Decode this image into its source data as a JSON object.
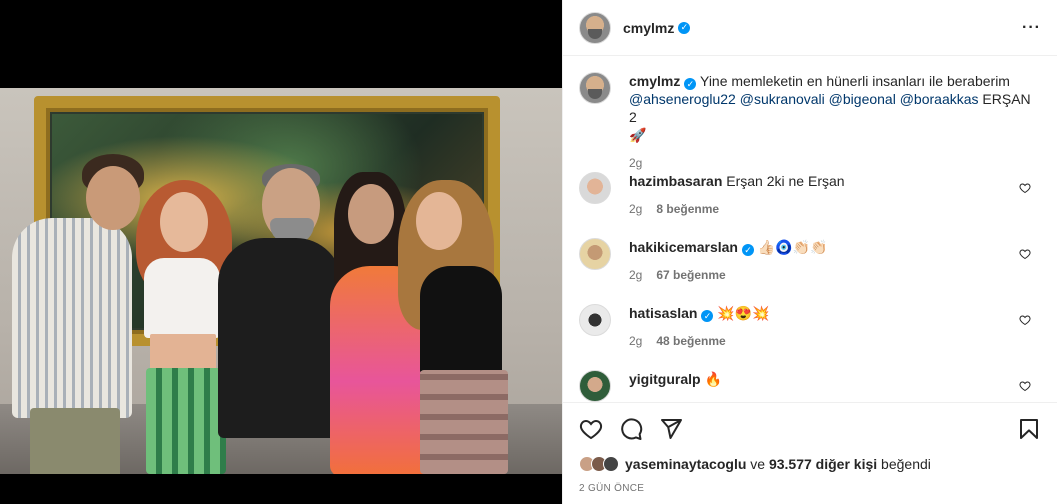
{
  "post": {
    "author": "cmylmz",
    "more_icon": "more-horizontal-icon"
  },
  "caption": {
    "username": "cmylmz",
    "text": "Yine memleketin en hünerli insanları ile beraberim",
    "mentions": [
      "@ahseneroglu22",
      "@sukranovali",
      "@bigeonal",
      "@boraakkas"
    ],
    "tail": "ERŞAN 2",
    "emoji": "🚀",
    "time": "2g"
  },
  "comments": [
    {
      "username": "hazimbasaran",
      "verified": false,
      "text": "Erşan 2ki ne Erşan",
      "time": "2g",
      "likes": "8 beğenme"
    },
    {
      "username": "hakikicemarslan",
      "verified": true,
      "text": "👍🏻🧿👏🏻👏🏻",
      "time": "2g",
      "likes": "67 beğenme"
    },
    {
      "username": "hatisaslan",
      "verified": true,
      "text": "💥😍💥",
      "time": "2g",
      "likes": "48 beğenme"
    },
    {
      "username": "yigitguralp",
      "verified": false,
      "text": "🔥",
      "time": "",
      "likes": ""
    }
  ],
  "likes_line": {
    "user": "yaseminaytacoglu",
    "conjunction": "ve",
    "count": "93.577 diğer kişi",
    "suffix": "beğendi"
  },
  "posted_ago": "2 GÜN ÖNCE",
  "colors": {
    "accent": "#0095f6",
    "mention": "#00376b",
    "muted": "#737373"
  }
}
